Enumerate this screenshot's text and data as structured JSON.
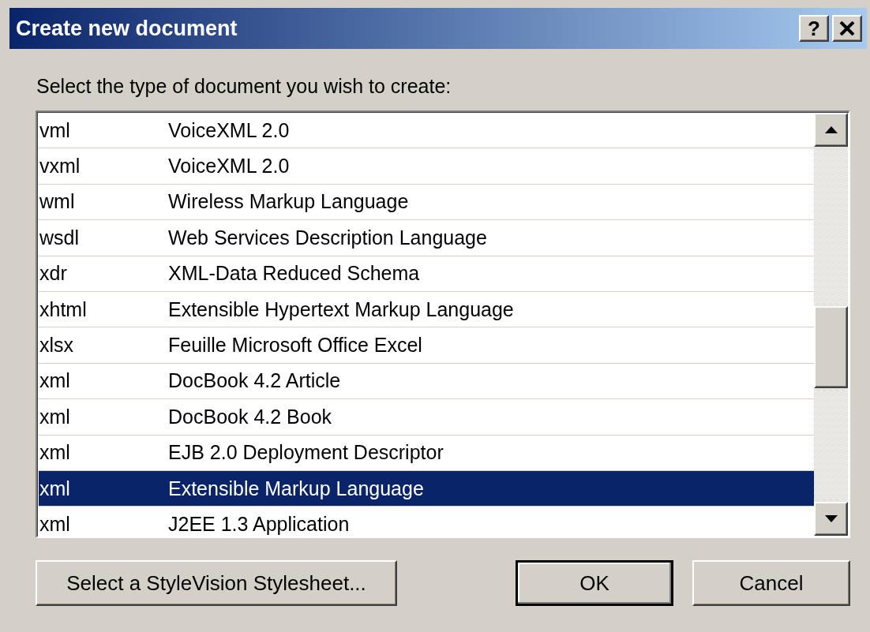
{
  "window": {
    "title": "Create new document",
    "help_button": "?"
  },
  "prompt": "Select the type of document you wish to create:",
  "document_types": {
    "rows": [
      {
        "extension": "vml",
        "description": "VoiceXML 2.0",
        "selected": false
      },
      {
        "extension": "vxml",
        "description": "VoiceXML 2.0",
        "selected": false
      },
      {
        "extension": "wml",
        "description": "Wireless Markup Language",
        "selected": false
      },
      {
        "extension": "wsdl",
        "description": "Web Services Description Language",
        "selected": false
      },
      {
        "extension": "xdr",
        "description": "XML-Data Reduced Schema",
        "selected": false
      },
      {
        "extension": "xhtml",
        "description": "Extensible Hypertext Markup Language",
        "selected": false
      },
      {
        "extension": "xlsx",
        "description": "Feuille Microsoft Office Excel",
        "selected": false
      },
      {
        "extension": "xml",
        "description": "DocBook 4.2 Article",
        "selected": false
      },
      {
        "extension": "xml",
        "description": "DocBook 4.2 Book",
        "selected": false
      },
      {
        "extension": "xml",
        "description": "EJB 2.0 Deployment Descriptor",
        "selected": false
      },
      {
        "extension": "xml",
        "description": "Extensible Markup Language",
        "selected": true
      },
      {
        "extension": "xml",
        "description": "J2EE 1.3 Application",
        "selected": false
      }
    ]
  },
  "buttons": [
    {
      "label": "Select a StyleVision Stylesheet...",
      "default": false
    },
    {
      "label": "OK",
      "default": true
    },
    {
      "label": "Cancel",
      "default": false
    }
  ]
}
